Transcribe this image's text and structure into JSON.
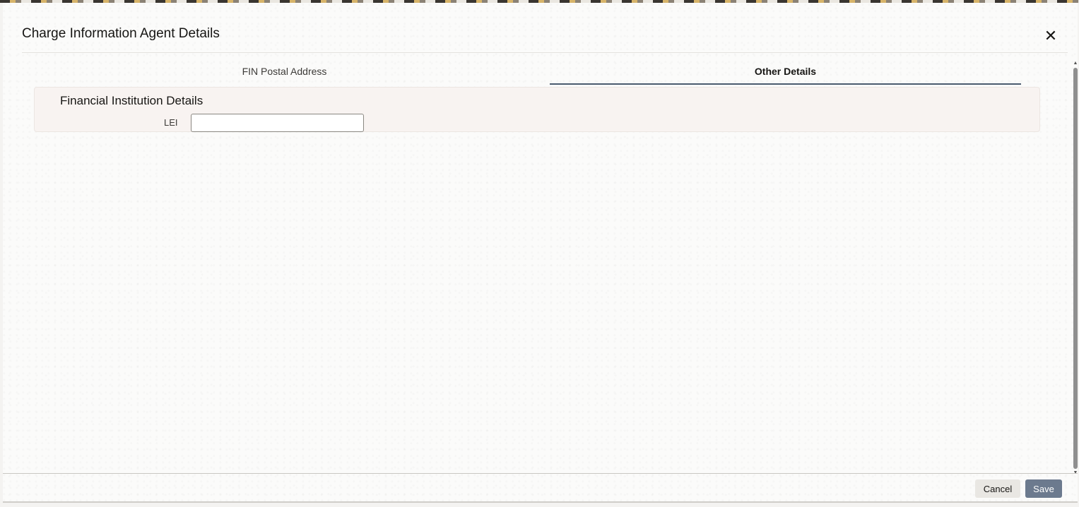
{
  "dialog": {
    "title": "Charge Information Agent Details",
    "close_icon": "close-icon"
  },
  "tabs": [
    {
      "label": "FIN Postal Address",
      "selected": false
    },
    {
      "label": "Other Details",
      "selected": true
    }
  ],
  "section": {
    "heading": "Financial Institution Details",
    "lei_label": "LEI",
    "lei_value": ""
  },
  "footer": {
    "cancel_label": "Cancel",
    "save_label": "Save"
  },
  "colors": {
    "accent": "#6c7a8e",
    "tab_underline": "#4a5a6e"
  }
}
